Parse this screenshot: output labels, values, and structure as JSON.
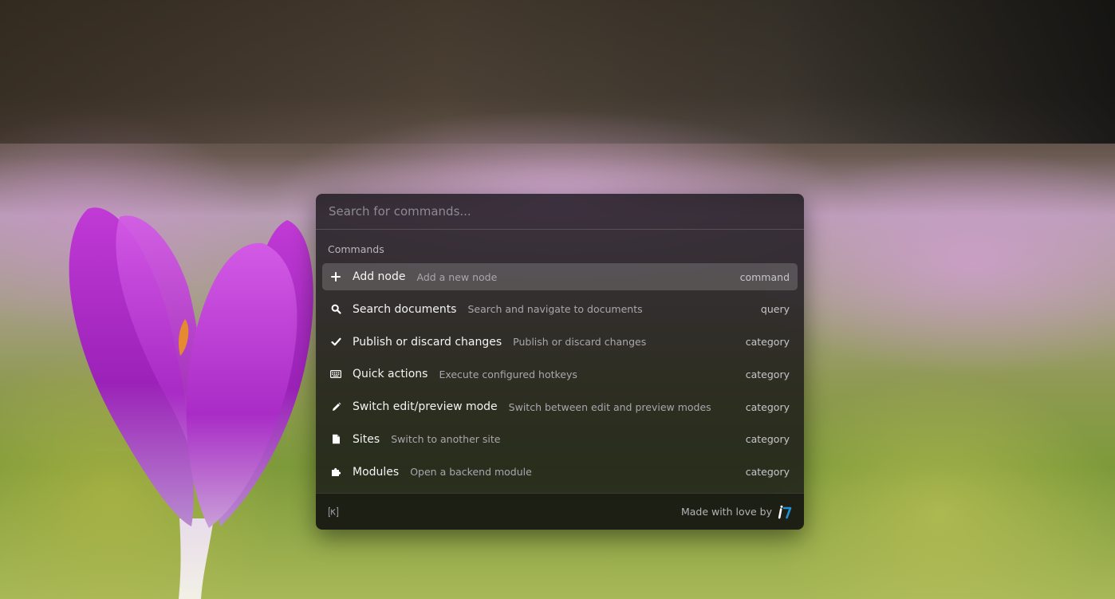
{
  "palette": {
    "search": {
      "value": "",
      "placeholder": "Search for commands..."
    },
    "group_label": "Commands",
    "items": [
      {
        "icon": "plus-icon",
        "name": "Add node",
        "description": "Add a new node",
        "type": "command",
        "selected": true
      },
      {
        "icon": "search-icon",
        "name": "Search documents",
        "description": "Search and navigate to documents",
        "type": "query",
        "selected": false
      },
      {
        "icon": "check-icon",
        "name": "Publish or discard changes",
        "description": "Publish or discard changes",
        "type": "category",
        "selected": false
      },
      {
        "icon": "keyboard-icon",
        "name": "Quick actions",
        "description": "Execute configured hotkeys",
        "type": "category",
        "selected": false
      },
      {
        "icon": "pencil-icon",
        "name": "Switch edit/preview mode",
        "description": "Switch between edit and preview modes",
        "type": "category",
        "selected": false
      },
      {
        "icon": "file-icon",
        "name": "Sites",
        "description": "Switch to another site",
        "type": "category",
        "selected": false
      },
      {
        "icon": "puzzle-icon",
        "name": "Modules",
        "description": "Open a backend module",
        "type": "category",
        "selected": false
      }
    ],
    "footer": {
      "credit_text": "Made with love by",
      "brand_logo_icon": "brand-logo-icon",
      "kbd_icon": "keyboard-shortcut-icon"
    }
  },
  "colors": {
    "palette_bg": "#121014",
    "selected_row": "#3a383c",
    "text_primary": "#f4f4f4",
    "text_secondary": "#aaa6ae",
    "brand_accent": "#1e90d6"
  }
}
